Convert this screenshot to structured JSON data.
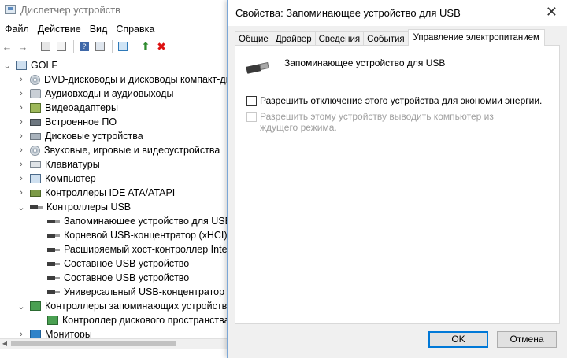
{
  "device_manager": {
    "title": "Диспетчер устройств",
    "menu": [
      "Файл",
      "Действие",
      "Вид",
      "Справка"
    ],
    "toolbar": [
      "back-icon",
      "forward-icon",
      "properties-icon",
      "help-icon",
      "update-icon",
      "scan-icon",
      "enable-icon",
      "uninstall-icon"
    ],
    "tree": {
      "root": "GOLF",
      "items": [
        {
          "label": "DVD-дисководы и дисководы компакт-ди",
          "icon": "disc-icon"
        },
        {
          "label": "Аудиовходы и аудиовыходы",
          "icon": "speaker-icon"
        },
        {
          "label": "Видеоадаптеры",
          "icon": "display-adapter-icon"
        },
        {
          "label": "Встроенное ПО",
          "icon": "firmware-icon"
        },
        {
          "label": "Дисковые устройства",
          "icon": "drive-icon"
        },
        {
          "label": "Звуковые, игровые и видеоустройства",
          "icon": "sound-icon"
        },
        {
          "label": "Клавиатуры",
          "icon": "keyboard-icon"
        },
        {
          "label": "Компьютер",
          "icon": "computer-icon"
        },
        {
          "label": "Контроллеры IDE ATA/ATAPI",
          "icon": "ide-icon"
        },
        {
          "label": "Контроллеры USB",
          "icon": "usb-icon",
          "expanded": true
        },
        {
          "label": "Запоминающее устройство для USB",
          "icon": "usb-icon",
          "child": true
        },
        {
          "label": "Корневой USB-концентратор (xHCI)",
          "icon": "usb-icon",
          "child": true
        },
        {
          "label": "Расширяемый хост-контроллер Intel(",
          "icon": "usb-icon",
          "child": true
        },
        {
          "label": "Составное USB устройство",
          "icon": "usb-icon",
          "child": true
        },
        {
          "label": "Составное USB устройство",
          "icon": "usb-icon",
          "child": true
        },
        {
          "label": "Универсальный USB-концентратор",
          "icon": "usb-icon",
          "child": true
        },
        {
          "label": "Контроллеры запоминающих устройств",
          "icon": "storage-icon",
          "expanded": true
        },
        {
          "label": "Контроллер дискового пространства",
          "icon": "storage-icon",
          "child": true
        },
        {
          "label": "Мониторы",
          "icon": "monitor-icon"
        }
      ]
    }
  },
  "dialog": {
    "title": "Свойства: Запоминающее устройство для USB",
    "tabs": [
      "Общие",
      "Драйвер",
      "Сведения",
      "События",
      "Управление электропитанием"
    ],
    "active_tab": "Управление электропитанием",
    "device_name": "Запоминающее устройство для USB",
    "checkbox_allow_off": "Разрешить отключение этого устройства для экономии энергии.",
    "checkbox_wake": "Разрешить этому устройству выводить компьютер из ждущего режима.",
    "ok": "OK",
    "cancel": "Отмена"
  }
}
